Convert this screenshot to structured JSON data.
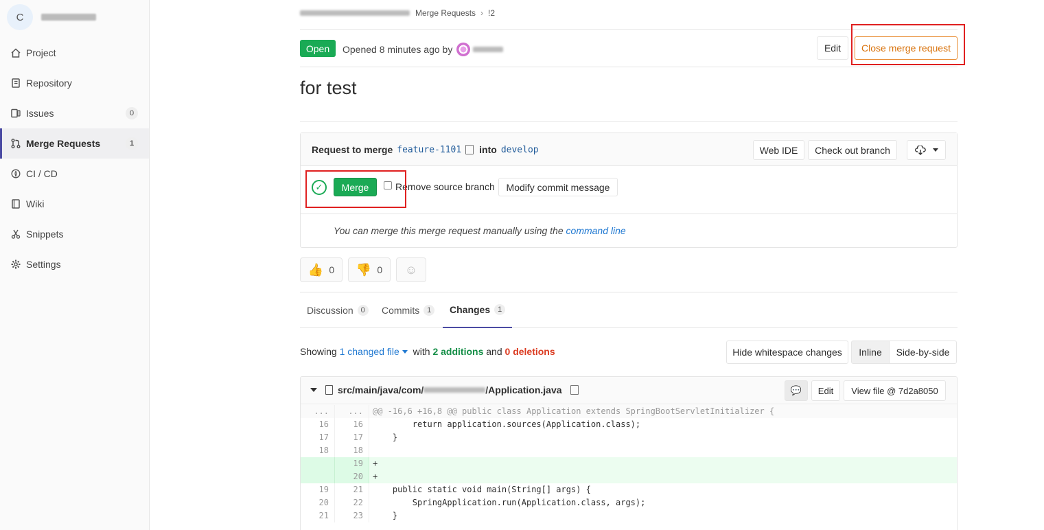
{
  "sidebar": {
    "project_initial": "C",
    "items": [
      {
        "label": "Project",
        "icon": "home-icon"
      },
      {
        "label": "Repository",
        "icon": "book-icon"
      },
      {
        "label": "Issues",
        "icon": "issues-icon",
        "count": "0"
      },
      {
        "label": "Merge Requests",
        "icon": "merge-request-icon",
        "count": "1"
      },
      {
        "label": "CI / CD",
        "icon": "rocket-icon"
      },
      {
        "label": "Wiki",
        "icon": "wiki-icon"
      },
      {
        "label": "Snippets",
        "icon": "scissors-icon"
      },
      {
        "label": "Settings",
        "icon": "gear-icon"
      }
    ]
  },
  "breadcrumb": {
    "merge_requests": "Merge Requests",
    "current": "!2"
  },
  "header": {
    "status": "Open",
    "opened_text": "Opened 8 minutes ago by",
    "edit_label": "Edit",
    "close_label": "Close merge request"
  },
  "title": "for test",
  "widget": {
    "request_prefix": "Request to merge",
    "source_branch": "feature-1101",
    "into": "into",
    "target_branch": "develop",
    "web_ide": "Web IDE",
    "checkout": "Check out branch",
    "merge_label": "Merge",
    "remove_source": "Remove source branch",
    "modify_commit": "Modify commit message",
    "manual_text": "You can merge this merge request manually using the",
    "command_line": "command line"
  },
  "awards": {
    "thumbs_up": "0",
    "thumbs_down": "0"
  },
  "tabs": [
    {
      "label": "Discussion",
      "count": "0"
    },
    {
      "label": "Commits",
      "count": "1"
    },
    {
      "label": "Changes",
      "count": "1"
    }
  ],
  "changes": {
    "showing": "Showing",
    "changed_files": "1 changed file",
    "with": "with",
    "additions": "2 additions",
    "and": "and",
    "deletions": "0 deletions",
    "hide_whitespace": "Hide whitespace changes",
    "inline": "Inline",
    "side_by_side": "Side-by-side"
  },
  "file": {
    "path_prefix": "src/main/java/com/",
    "path_suffix": "/Application.java",
    "edit_label": "Edit",
    "view_file": "View file @ 7d2a8050"
  },
  "diff": [
    {
      "old": "...",
      "new": "...",
      "type": "meta",
      "code": "@@ -16,6 +16,8 @@ public class Application extends SpringBootServletInitializer {"
    },
    {
      "old": "16",
      "new": "16",
      "type": "ctx",
      "code": "        return application.sources(Application.class);"
    },
    {
      "old": "17",
      "new": "17",
      "type": "ctx",
      "code": "    }"
    },
    {
      "old": "18",
      "new": "18",
      "type": "ctx",
      "code": ""
    },
    {
      "old": "",
      "new": "19",
      "type": "add",
      "code": "+"
    },
    {
      "old": "",
      "new": "20",
      "type": "add",
      "code": "+"
    },
    {
      "old": "19",
      "new": "21",
      "type": "ctx",
      "code": "    public static void main(String[] args) {"
    },
    {
      "old": "20",
      "new": "22",
      "type": "ctx",
      "code": "        SpringApplication.run(Application.class, args);"
    },
    {
      "old": "21",
      "new": "23",
      "type": "ctx",
      "code": "    }"
    }
  ],
  "colors": {
    "accent": "#4b4ba3",
    "success": "#1aaa55",
    "warning": "#d9730d",
    "highlight_box": "#e02020"
  }
}
